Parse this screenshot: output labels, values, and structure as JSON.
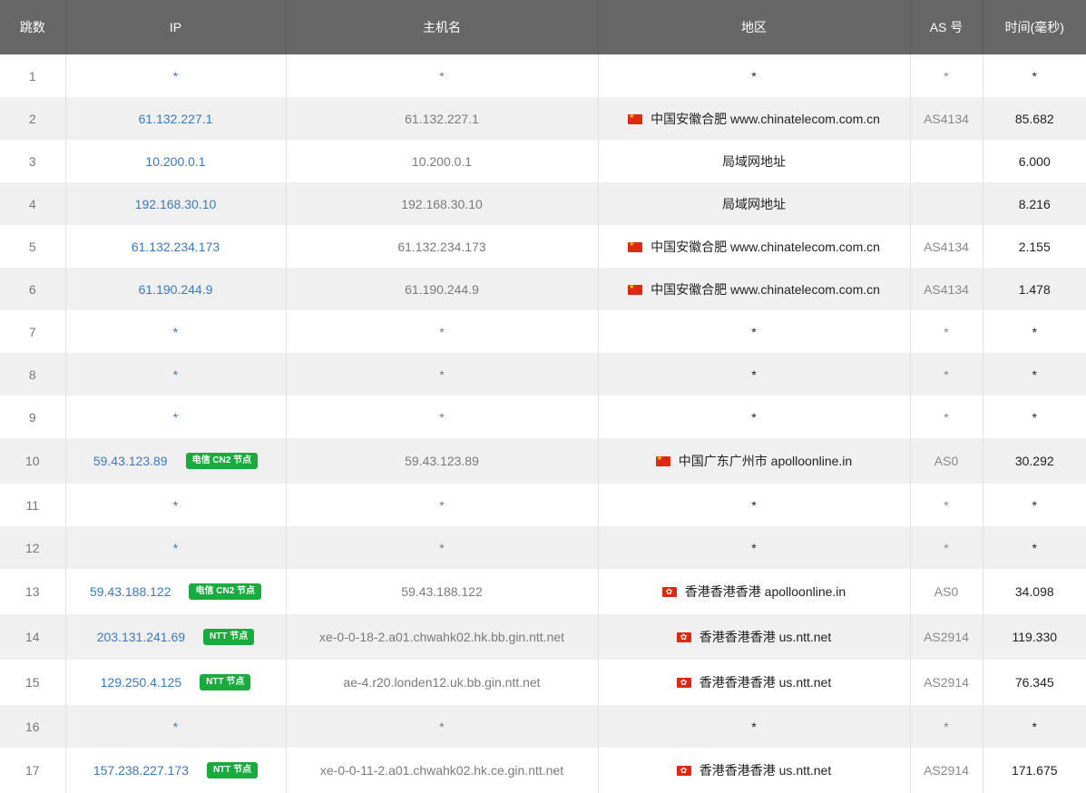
{
  "columns": {
    "hop": "跳数",
    "ip": "IP",
    "hostname": "主机名",
    "region": "地区",
    "as": "AS 号",
    "time": "时间(毫秒)"
  },
  "rows": [
    {
      "hop": "1",
      "ip": "*",
      "badge": "",
      "host": "*",
      "flag": "",
      "region": "*",
      "as": "*",
      "time": "*"
    },
    {
      "hop": "2",
      "ip": "61.132.227.1",
      "badge": "",
      "host": "61.132.227.1",
      "flag": "cn-flag-icon",
      "region": "中国安徽合肥 www.chinatelecom.com.cn",
      "as": "AS4134",
      "time": "85.682"
    },
    {
      "hop": "3",
      "ip": "10.200.0.1",
      "badge": "",
      "host": "10.200.0.1",
      "flag": "",
      "region": "局域网地址",
      "as": "",
      "time": "6.000"
    },
    {
      "hop": "4",
      "ip": "192.168.30.10",
      "badge": "",
      "host": "192.168.30.10",
      "flag": "",
      "region": "局域网地址",
      "as": "",
      "time": "8.216"
    },
    {
      "hop": "5",
      "ip": "61.132.234.173",
      "badge": "",
      "host": "61.132.234.173",
      "flag": "cn-flag-icon",
      "region": "中国安徽合肥 www.chinatelecom.com.cn",
      "as": "AS4134",
      "time": "2.155"
    },
    {
      "hop": "6",
      "ip": "61.190.244.9",
      "badge": "",
      "host": "61.190.244.9",
      "flag": "cn-flag-icon",
      "region": "中国安徽合肥 www.chinatelecom.com.cn",
      "as": "AS4134",
      "time": "1.478"
    },
    {
      "hop": "7",
      "ip": "*",
      "badge": "",
      "host": "*",
      "flag": "",
      "region": "*",
      "as": "*",
      "time": "*"
    },
    {
      "hop": "8",
      "ip": "*",
      "badge": "",
      "host": "*",
      "flag": "",
      "region": "*",
      "as": "*",
      "time": "*"
    },
    {
      "hop": "9",
      "ip": "*",
      "badge": "",
      "host": "*",
      "flag": "",
      "region": "*",
      "as": "*",
      "time": "*"
    },
    {
      "hop": "10",
      "ip": "59.43.123.89",
      "badge": "电信 CN2 节点",
      "host": "59.43.123.89",
      "flag": "cn-flag-icon",
      "region": "中国广东广州市 apolloonline.in",
      "as": "AS0",
      "time": "30.292"
    },
    {
      "hop": "11",
      "ip": "*",
      "badge": "",
      "host": "*",
      "flag": "",
      "region": "*",
      "as": "*",
      "time": "*"
    },
    {
      "hop": "12",
      "ip": "*",
      "badge": "",
      "host": "*",
      "flag": "",
      "region": "*",
      "as": "*",
      "time": "*"
    },
    {
      "hop": "13",
      "ip": "59.43.188.122",
      "badge": "电信 CN2 节点",
      "host": "59.43.188.122",
      "flag": "hk-flag-icon",
      "region": "香港香港香港 apolloonline.in",
      "as": "AS0",
      "time": "34.098"
    },
    {
      "hop": "14",
      "ip": "203.131.241.69",
      "badge": "NTT 节点",
      "host": "xe-0-0-18-2.a01.chwahk02.hk.bb.gin.ntt.net",
      "flag": "hk-flag-icon",
      "region": "香港香港香港 us.ntt.net",
      "as": "AS2914",
      "time": "119.330"
    },
    {
      "hop": "15",
      "ip": "129.250.4.125",
      "badge": "NTT 节点",
      "host": "ae-4.r20.londen12.uk.bb.gin.ntt.net",
      "flag": "hk-flag-icon",
      "region": "香港香港香港 us.ntt.net",
      "as": "AS2914",
      "time": "76.345"
    },
    {
      "hop": "16",
      "ip": "*",
      "badge": "",
      "host": "*",
      "flag": "",
      "region": "*",
      "as": "*",
      "time": "*"
    },
    {
      "hop": "17",
      "ip": "157.238.227.173",
      "badge": "NTT 节点",
      "host": "xe-0-0-11-2.a01.chwahk02.hk.ce.gin.ntt.net",
      "flag": "hk-flag-icon",
      "region": "香港香港香港 us.ntt.net",
      "as": "AS2914",
      "time": "171.675"
    }
  ],
  "colors": {
    "header_bg": "#676767",
    "header_text": "#ffffff",
    "row_alt_bg": "#f0f0f0",
    "ip_link": "#3b78c4",
    "badge_bg": "#1aab3f"
  }
}
